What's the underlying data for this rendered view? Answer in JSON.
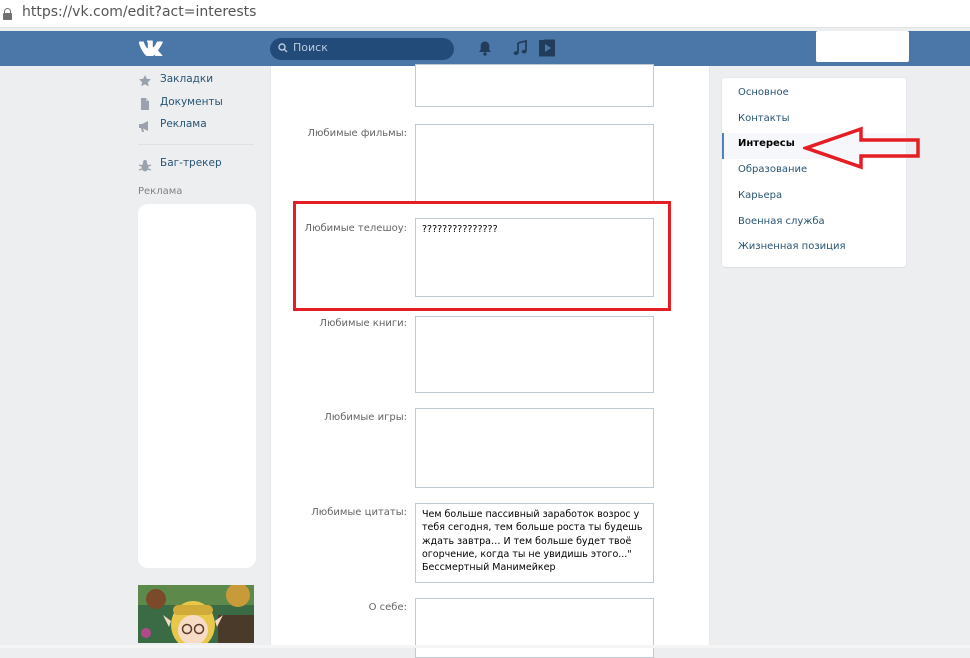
{
  "browser": {
    "url": "https://vk.com/edit?act=interests"
  },
  "header": {
    "search_placeholder": "Поиск",
    "icons": [
      "vk-logo-icon",
      "search-icon",
      "bell-icon",
      "music-icon",
      "video-play-icon"
    ],
    "accent_color": "#4a76a8"
  },
  "left_nav": {
    "items": [
      {
        "label": "Закладки",
        "icon": "star-icon"
      },
      {
        "label": "Документы",
        "icon": "document-icon"
      },
      {
        "label": "Реклама",
        "icon": "megaphone-icon"
      }
    ],
    "bug_tracker": {
      "label": "Баг-трекер",
      "icon": "bug-icon"
    },
    "ads_label": "Реклама"
  },
  "form": {
    "fields": [
      {
        "label": "",
        "value": ""
      },
      {
        "label": "Любимые фильмы:",
        "value": ""
      },
      {
        "label": "Любимые телешоу:",
        "value": "???????????????"
      },
      {
        "label": "Любимые книги:",
        "value": ""
      },
      {
        "label": "Любимые игры:",
        "value": ""
      },
      {
        "label": "Любимые цитаты:",
        "value": "Чем больше пассивный заработок возрос у тебя сегодня, тем больше роста ты будешь ждать завтра… И тем больше будет твоё огорчение, когда ты не увидишь этого...\" Бессмертный Манимейкер"
      },
      {
        "label": "О себе:",
        "value": ""
      }
    ]
  },
  "right_menu": {
    "items": [
      {
        "label": "Основное",
        "active": false
      },
      {
        "label": "Контакты",
        "active": false
      },
      {
        "label": "Интересы",
        "active": true
      },
      {
        "label": "Образование",
        "active": false
      },
      {
        "label": "Карьера",
        "active": false
      },
      {
        "label": "Военная служба",
        "active": false
      },
      {
        "label": "Жизненная позиция",
        "active": false
      }
    ]
  },
  "annotation": {
    "color": "#e31e25"
  }
}
